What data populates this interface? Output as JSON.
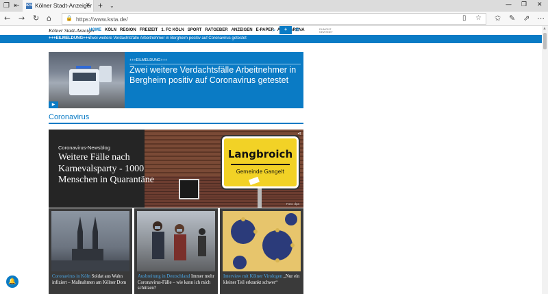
{
  "browser": {
    "tab_title": "Kölner Stadt-Anzeiger",
    "tab_favicon": "KStA",
    "url": "https://www.ksta.de/",
    "new_tab": "+",
    "new_tab_dropdown": "⌄"
  },
  "site": {
    "logo": "Kölner Stadt-Anzeiger",
    "nav": [
      "HOME",
      "KÖLN",
      "REGION",
      "FREIZEIT",
      "1. FC KÖLN",
      "SPORT",
      "RATGEBER",
      "ANZEIGEN",
      "E-PAPER",
      "ABO",
      "ARENA"
    ],
    "plus_label": "+",
    "dumont": "DUMONT NEWSNET"
  },
  "ticker": {
    "label": "+++EILMELDUNG+++",
    "text": "Zwei weitere Verdachtsfälle  Arbeitnehmer in Bergheim positiv auf Coronavirus getestet"
  },
  "breaking": {
    "label": "+++EILMELDUNG+++",
    "title": "Zwei weitere Verdachtsfälle  Arbeitnehmer in Bergheim positiv auf Coronavirus getestet"
  },
  "section": {
    "title": "Coronavirus"
  },
  "hero": {
    "kicker": "Coronavirus-Newsblog",
    "title": "Weitere Fälle nach Karnevalsparty - 1000 Menschen in Quarantäne",
    "sign_name": "Langbroich",
    "sign_sub": "Gemeinde Gangelt",
    "photo_credit": "Foto: dpa"
  },
  "cards": [
    {
      "kicker": "Coronavirus in Köln",
      "title": "Coronavirus in Köln  Soldat aus Wahn infiziert – Maßnahmen am Kölner Dom"
    },
    {
      "kicker": "Ausbreitung in Deutschland",
      "title": "Ausbreitung in Deutschland  Immer mehr Coronavirus-Fälle – wie kann ich mich schützen?"
    },
    {
      "kicker": "Interview mit Kölner Virologen",
      "title": "Interview mit Kölner Virologen  „Nur ein kleiner Teil erkrankt schwer“"
    }
  ],
  "icons": {
    "back": "arrow-left-icon",
    "forward": "arrow-right-icon",
    "reload": "reload-icon",
    "home": "home-icon",
    "lock": "lock-icon",
    "star": "star-icon",
    "bell": "bell-icon"
  },
  "colors": {
    "brand_blue": "#0a7bc5",
    "sign_yellow": "#f2d226"
  }
}
